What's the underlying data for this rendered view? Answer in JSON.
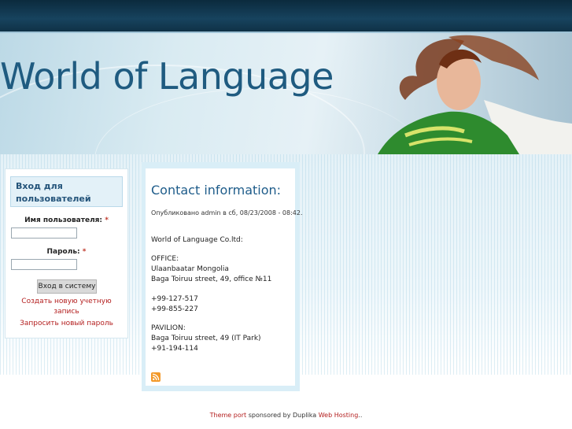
{
  "site": {
    "title": "World of Language"
  },
  "login": {
    "block_title": "Вход для пользователей",
    "username_label": "Имя пользователя:",
    "password_label": "Пароль:",
    "required_mark": "*",
    "username_value": "",
    "password_value": "",
    "submit_label": "Вход в систему",
    "create_account_line1": "Создать новую учетную",
    "create_account_line2": "запись",
    "request_password": "Запросить новый пароль"
  },
  "node": {
    "title": "Contact information:",
    "meta": "Опубликовано admin в сб, 08/23/2008 - 08:42.",
    "company": "World of Language Co.ltd:",
    "office_heading": "OFFICE:",
    "office_city": "Ulaanbaatar Mongolia",
    "office_address": "Baga Toiruu street, 49, office №11",
    "phone1": "+99-127-517",
    "phone2": "+99-855-227",
    "pavilion_heading": "PAVILION:",
    "pavilion_address": "Baga Toiruu street, 49 (IT Park)",
    "phone3": "+91-194-114"
  },
  "footer": {
    "theme_link": "Theme port",
    "sponsored_text": "sponsored by Duplika",
    "hosting_link": "Web Hosting",
    "trailing": ".."
  },
  "icons": {
    "rss": "rss-feed-icon"
  },
  "colors": {
    "accent": "#1e5c8a",
    "link": "#b31e1e",
    "topbar": "#0f3146"
  }
}
